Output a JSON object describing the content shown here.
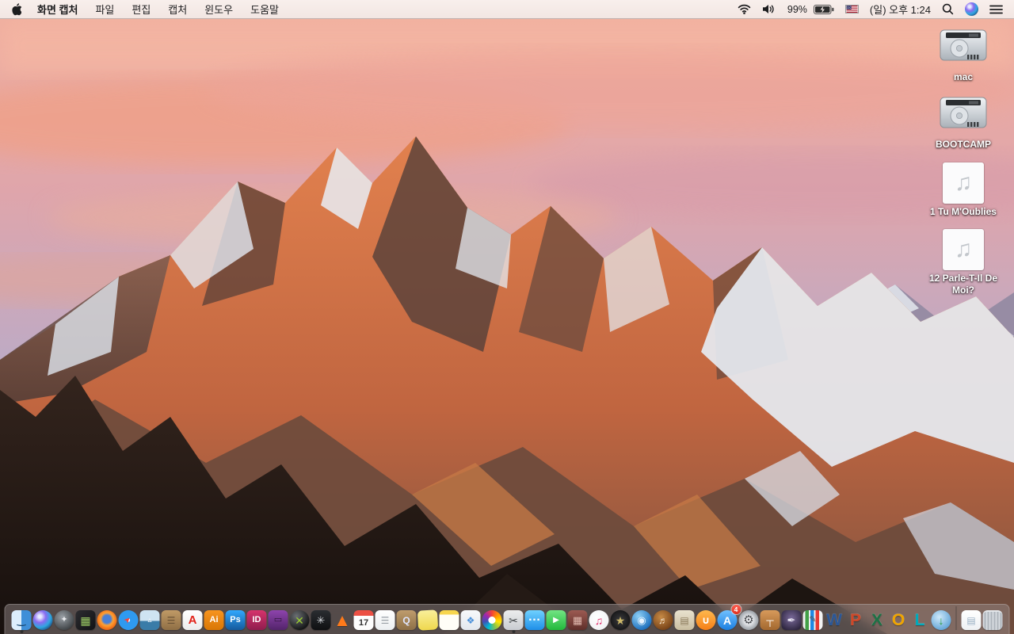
{
  "menu_bar": {
    "app_name": "화면 캡처",
    "menus": [
      "파일",
      "편집",
      "캡처",
      "윈도우",
      "도움말"
    ],
    "status": {
      "battery_percent": "99%",
      "battery_charging": true,
      "flag": "us-flag",
      "datetime": "(일) 오후 1:24"
    }
  },
  "desktop": {
    "icons": [
      {
        "type": "drive",
        "name": "drive-mac",
        "label": "mac"
      },
      {
        "type": "drive",
        "name": "drive-bootcamp",
        "label": "BOOTCAMP"
      },
      {
        "type": "music",
        "name": "audio-file-1",
        "label": "1 Tu M'Oublies",
        "glyph": "♫"
      },
      {
        "type": "music",
        "name": "audio-file-12",
        "label": "12 Parle-T-Il De Moi?",
        "glyph": "♫"
      }
    ]
  },
  "dock": {
    "items": [
      {
        "name": "finder",
        "shape": "rounded",
        "bg": "linear-gradient(90deg,#dceefc 0 50%,#3f8fd8 50%)",
        "glyph": "‿",
        "fg": "#17456e",
        "fs": 13,
        "running": true
      },
      {
        "name": "siri",
        "shape": "circle",
        "bg": "radial-gradient(circle at 35% 32%,#e8ecff 0 8%,#8a6bf0 32%,#2ea7e0 58%,#15154a 95%)",
        "glyph": "",
        "fg": "#fff",
        "fs": 10
      },
      {
        "name": "launchpad",
        "shape": "circle",
        "bg": "radial-gradient(circle at 40% 35%,#9aa0a6,#3c4043 78%)",
        "glyph": "✦",
        "fg": "#e8eaed",
        "fs": 11
      },
      {
        "name": "mission-control",
        "shape": "rounded",
        "bg": "linear-gradient(135deg,#2c2c30,#121215)",
        "glyph": "▦",
        "fg": "#9ccc65",
        "fs": 14
      },
      {
        "name": "firefox",
        "shape": "circle",
        "bg": "radial-gradient(circle at 50% 45%,#4a7fd6 0 27%,#ffa033 43%,#e8590c 78%)",
        "glyph": "",
        "fg": "#fff",
        "fs": 10
      },
      {
        "name": "safari",
        "shape": "circle",
        "bg": "radial-gradient(circle at 50% 50%,#f8fbff 0 12%,#2f9af0 13% 80%,#d7dde3 81%)",
        "glyph": "➤",
        "fg": "#ff3b30",
        "fs": 10,
        "rot": -45
      },
      {
        "name": "preview",
        "shape": "rounded",
        "bg": "linear-gradient(#cfe4f2 0 55%,#3a7ca8 55%)",
        "glyph": "▵",
        "fg": "#f2f6fa",
        "fs": 10
      },
      {
        "name": "contacts",
        "shape": "rounded",
        "bg": "linear-gradient(#c09a66,#8f6f45)",
        "glyph": "☰",
        "fg": "#6b5336",
        "fs": 12
      },
      {
        "name": "adobe-acrobat",
        "shape": "rounded",
        "bg": "linear-gradient(#ffffff,#ececec)",
        "glyph": "A",
        "fg": "#e2231a",
        "fs": 15
      },
      {
        "name": "adobe-illustrator",
        "shape": "rounded",
        "bg": "linear-gradient(#f7941e,#d97706)",
        "glyph": "Ai",
        "fg": "#fff",
        "fs": 11
      },
      {
        "name": "adobe-photoshop",
        "shape": "rounded",
        "bg": "linear-gradient(#31a8ff,#155a9c)",
        "glyph": "Ps",
        "fg": "#fff",
        "fs": 11
      },
      {
        "name": "adobe-indesign",
        "shape": "rounded",
        "bg": "linear-gradient(#d6336c,#8f1d4e)",
        "glyph": "ID",
        "fg": "#fff",
        "fs": 11
      },
      {
        "name": "toast-titanium",
        "shape": "rounded",
        "bg": "linear-gradient(#8e44ad,#53246b)",
        "glyph": "▭",
        "fg": "#2c1338",
        "fs": 11
      },
      {
        "name": "green-x-sphere-app",
        "shape": "circle",
        "bg": "radial-gradient(circle at 35% 30%,#6b6f73,#101112 78%)",
        "glyph": "✕",
        "fg": "#9acd32",
        "fs": 14
      },
      {
        "name": "disk-speed-test",
        "shape": "rounded",
        "bg": "linear-gradient(#2a2d31,#0f1012)",
        "glyph": "✳",
        "fg": "#d8dbdf",
        "fs": 13
      },
      {
        "name": "vlc",
        "shape": "none",
        "bg": "transparent",
        "glyph": "▲",
        "fg": "#ff7a1a",
        "fs": 22,
        "cls": "vlc"
      },
      {
        "name": "calendar",
        "shape": "rounded",
        "bg": "linear-gradient(#ec5044 0 27%,#fdfdfd 27%)",
        "glyph": "17",
        "fg": "#333333",
        "fs": 11,
        "cls": "cal"
      },
      {
        "name": "reminders",
        "shape": "rounded",
        "bg": "linear-gradient(#ffffff,#eceff1)",
        "glyph": "☰",
        "fg": "#9aa0a6",
        "fs": 12
      },
      {
        "name": "converter-box-app",
        "shape": "rounded",
        "bg": "linear-gradient(#bf9d6d,#8d6f47)",
        "glyph": "Q",
        "fg": "#dfe6ff",
        "fs": 12
      },
      {
        "name": "stickies",
        "shape": "rounded",
        "bg": "linear-gradient(#f9ef9a,#efd84e)",
        "glyph": "",
        "fg": "#c9b23a",
        "fs": 10,
        "cls": "stickies"
      },
      {
        "name": "notes",
        "shape": "rounded",
        "bg": "linear-gradient(#f7d64e 0 22%,#fffef7 22%)",
        "glyph": "",
        "fg": "#ddd",
        "fs": 10
      },
      {
        "name": "documents-app",
        "shape": "rounded",
        "bg": "linear-gradient(#f7f9fb,#e3e8ee)",
        "glyph": "❖",
        "fg": "#4a90d9",
        "fs": 12
      },
      {
        "name": "photos",
        "shape": "circle",
        "bg": "radial-gradient(circle,#ffffff 0 25%,rgba(255,255,255,0) 26%),conic-gradient(#f44336,#ff9800,#ffe600,#8bc34a,#00bcd4,#3f51b5,#9c27b0,#f44336)",
        "glyph": "",
        "fg": "#fff",
        "fs": 10
      },
      {
        "name": "grab-screen-capture",
        "shape": "rounded",
        "bg": "linear-gradient(#eceded,#c9ccd1)",
        "glyph": "✂",
        "fg": "#3c4043",
        "fs": 14,
        "running": true
      },
      {
        "name": "messages",
        "shape": "rounded",
        "bg": "linear-gradient(#6fd1ff,#1f8fe8)",
        "glyph": "…",
        "fg": "#ffffff",
        "fs": 16,
        "cls": "msg"
      },
      {
        "name": "facetime",
        "shape": "rounded",
        "bg": "linear-gradient(#72e483,#23b93d)",
        "glyph": "▶",
        "fg": "#ffffff",
        "fs": 10
      },
      {
        "name": "photo-booth",
        "shape": "rounded",
        "bg": "linear-gradient(#9c5a52,#5f2f2a)",
        "glyph": "▦",
        "fg": "#e0b8ae",
        "fs": 13
      },
      {
        "name": "itunes",
        "shape": "circle",
        "bg": "radial-gradient(circle at 40% 35%,#ffffff,#f2f3f5 70%,#d9dce0)",
        "glyph": "♫",
        "fg": "#e0356f",
        "fs": 14
      },
      {
        "name": "imovie",
        "shape": "circle",
        "bg": "radial-gradient(circle,#3b3b3e,#141416 78%)",
        "glyph": "★",
        "fg": "#cdb96a",
        "fs": 14
      },
      {
        "name": "dvd-ripper-app",
        "shape": "circle",
        "bg": "radial-gradient(circle at 35% 30%,#8fd0f5,#1266b8 82%)",
        "glyph": "◉",
        "fg": "#e8f4ff",
        "fs": 13
      },
      {
        "name": "garageband",
        "shape": "circle",
        "bg": "radial-gradient(circle at 40% 35%,#c78b47,#6f3b12 82%)",
        "glyph": "♬",
        "fg": "#f5e6d0",
        "fs": 12
      },
      {
        "name": "scrapbook-app",
        "shape": "rounded",
        "bg": "linear-gradient(#e9e2cf,#c9bda0)",
        "glyph": "▤",
        "fg": "#8a7a5a",
        "fs": 12
      },
      {
        "name": "ibooks",
        "shape": "circle",
        "bg": "linear-gradient(#ffb84d,#f57f17)",
        "glyph": "∪",
        "fg": "#ffffff",
        "fs": 13
      },
      {
        "name": "app-store",
        "shape": "circle",
        "bg": "linear-gradient(#6fc0ff,#1c7fe0)",
        "glyph": "A",
        "fg": "#ffffff",
        "fs": 14,
        "badge": "4"
      },
      {
        "name": "system-preferences",
        "shape": "circle",
        "bg": "radial-gradient(circle,#e8eaed 0 28%,#9aa0a6 70%,#5f6368)",
        "glyph": "⚙",
        "fg": "#4a4d51",
        "fs": 15
      },
      {
        "name": "keynote",
        "shape": "rounded",
        "bg": "linear-gradient(#d79a5b,#a3682f)",
        "glyph": "┬",
        "fg": "#ffffff",
        "fs": 13
      },
      {
        "name": "pages",
        "shape": "rounded",
        "bg": "radial-gradient(circle at 50% 40%,#7a6a9a,#2f2741 82%)",
        "glyph": "✒",
        "fg": "#e8e4f2",
        "fs": 13
      },
      {
        "name": "numbers",
        "shape": "rounded",
        "bg": "linear-gradient(90deg,#f2f2f2 0 12%,#43a047 12% 30%,#f2f2f2 30% 38%,#1e88e5 38% 56%,#f2f2f2 56% 64%,#e53935 64% 82%,#f2f2f2 82%)",
        "glyph": "✎",
        "fg": "#555555",
        "fs": 11
      },
      {
        "name": "ms-word",
        "shape": "none",
        "bg": "transparent",
        "glyph": "W",
        "fg": "#2b5797",
        "fs": 21,
        "cls": "letter"
      },
      {
        "name": "ms-powerpoint",
        "shape": "none",
        "bg": "transparent",
        "glyph": "P",
        "fg": "#d04727",
        "fs": 21,
        "cls": "letter"
      },
      {
        "name": "ms-excel",
        "shape": "none",
        "bg": "transparent",
        "glyph": "X",
        "fg": "#1e7145",
        "fs": 21,
        "cls": "letter"
      },
      {
        "name": "ms-outlook",
        "shape": "none",
        "bg": "transparent",
        "glyph": "O",
        "fg": "#f0a500",
        "fs": 21,
        "cls": "letter"
      },
      {
        "name": "ms-lync",
        "shape": "none",
        "bg": "transparent",
        "glyph": "L",
        "fg": "#00aabb",
        "fs": 21,
        "cls": "letter"
      },
      {
        "name": "downloader-app",
        "shape": "circle",
        "bg": "radial-gradient(circle at 40% 35%,#cfe9fa,#5a9fd4 82%)",
        "glyph": "↓",
        "fg": "#2e9e3f",
        "fs": 14
      },
      {
        "name": "separator",
        "type": "sep"
      },
      {
        "name": "document-file",
        "shape": "rounded",
        "bg": "linear-gradient(#ffffff,#eef1f4)",
        "glyph": "▤",
        "fg": "#9ab0c4",
        "fs": 12
      },
      {
        "name": "trash-full",
        "shape": "rounded",
        "bg": "repeating-linear-gradient(90deg,#d7dbe0 0 2px,#aeb4bb 2px 4px)",
        "glyph": "",
        "fg": "#fff",
        "fs": 10,
        "cls": "trash"
      }
    ]
  }
}
